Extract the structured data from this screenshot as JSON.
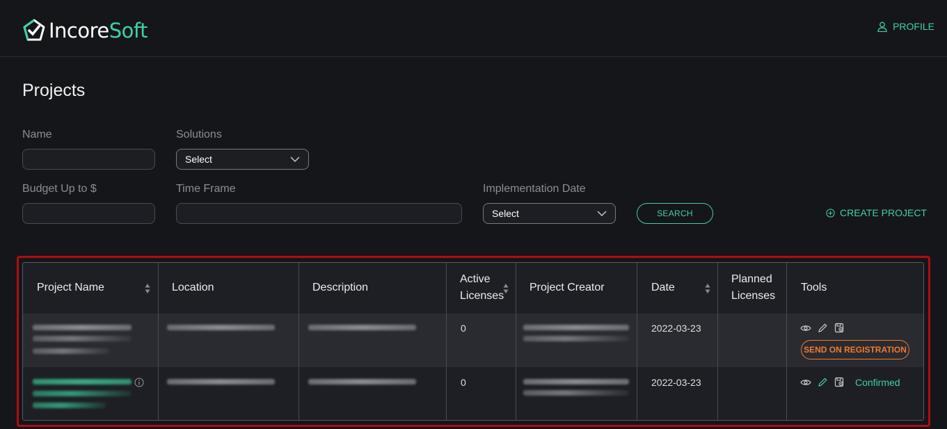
{
  "header": {
    "logo_text_a": "Incore",
    "logo_text_b": "Soft",
    "profile_label": "PROFILE"
  },
  "page_title": "Projects",
  "filters": {
    "name_label": "Name",
    "solutions_label": "Solutions",
    "solutions_value": "Select",
    "budget_label": "Budget Up to $",
    "timeframe_label": "Time Frame",
    "impl_date_label": "Implementation Date",
    "impl_date_value": "Select",
    "search_label": "SEARCH",
    "create_label": "CREATE PROJECT"
  },
  "table": {
    "columns": [
      "Project Name",
      "Location",
      "Description",
      "Active",
      "Licenses",
      "Project Creator",
      "Date",
      "Planned",
      "Licenses",
      "Tools"
    ],
    "rows": [
      {
        "active_licenses": "0",
        "date": "2022-03-23",
        "action_label": "SEND ON REGISTRATION"
      },
      {
        "active_licenses": "0",
        "date": "2022-03-23",
        "status_label": "Confirmed"
      }
    ]
  },
  "colors": {
    "accent": "#3fd0a8",
    "warning": "#f07a2f",
    "highlight": "#b00c10",
    "background": "#15161a"
  }
}
